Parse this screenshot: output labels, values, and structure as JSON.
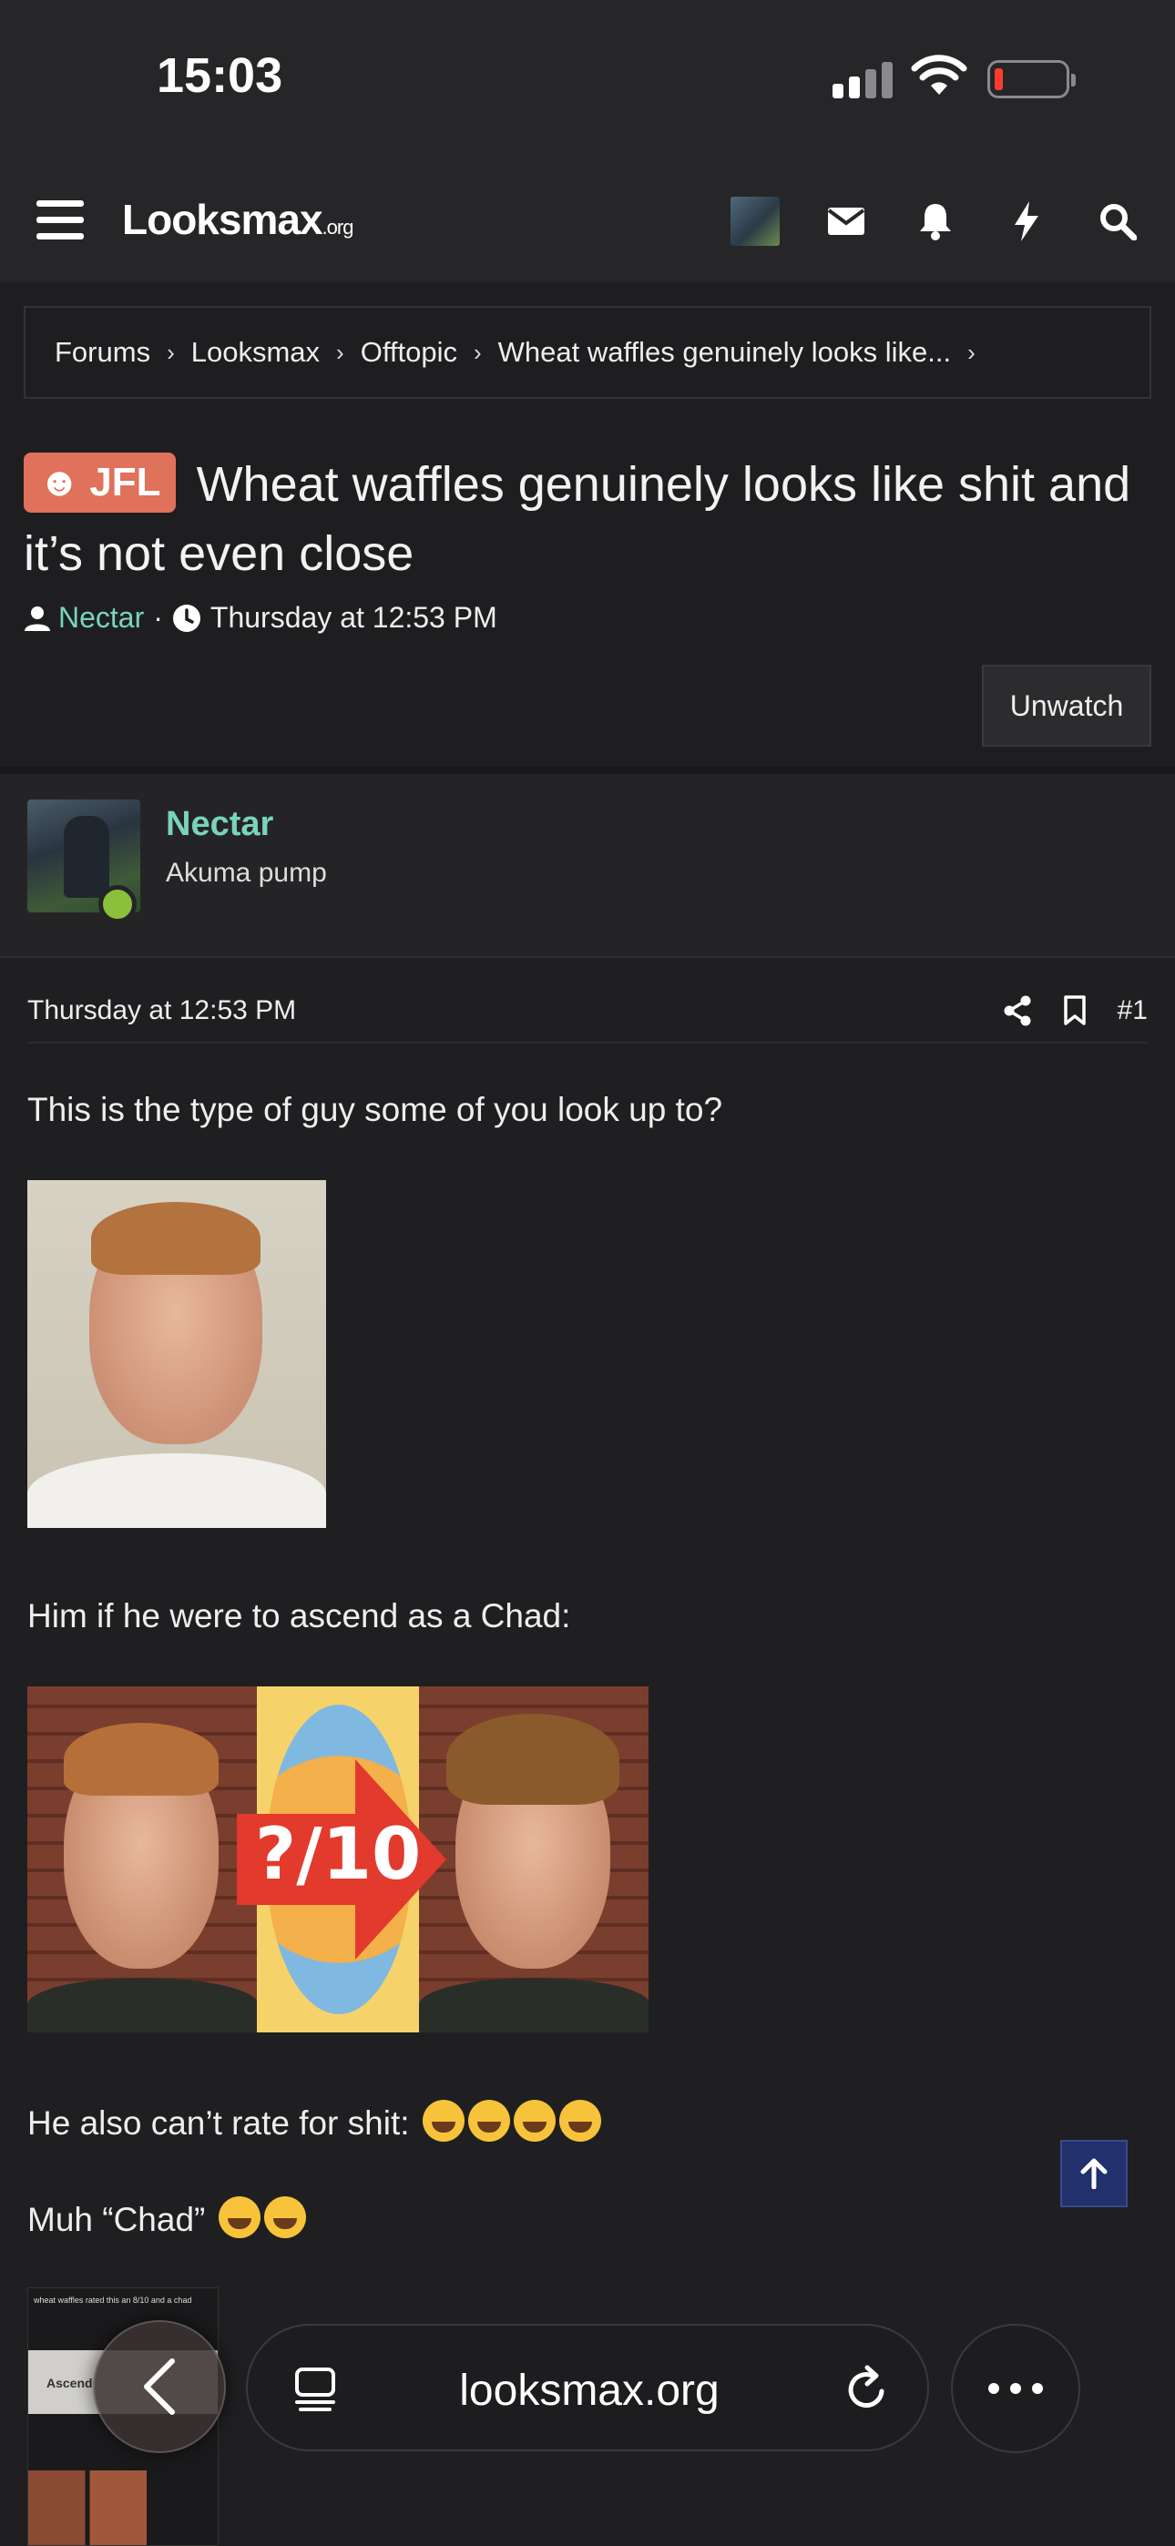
{
  "status_bar": {
    "time": "15:03"
  },
  "header": {
    "logo_main": "Looksmax",
    "logo_suffix": ".org",
    "icons": [
      "menu-icon",
      "avatar",
      "mail-icon",
      "bell-icon",
      "lightning-icon",
      "search-icon"
    ]
  },
  "breadcrumb": {
    "items": [
      "Forums",
      "Looksmax",
      "Offtopic",
      "Wheat waffles genuinely looks like..."
    ]
  },
  "thread": {
    "prefix": "JFL",
    "title": "Wheat waffles genuinely looks like shit and it’s not even close",
    "author": "Nectar",
    "separator": "·",
    "date": "Thursday at 12:53 PM",
    "unwatch_label": "Unwatch"
  },
  "post": {
    "author": "Nectar",
    "user_title": "Akuma pump",
    "date": "Thursday at 12:53 PM",
    "number": "#1",
    "paragraphs": [
      "This is the type of guy some of you look up to?",
      "Him if he were to ascend as a Chad:",
      "He also can’t rate for shit:",
      "Muh “Chad”"
    ],
    "rating_overlay": "?/10",
    "thumb_caption": "wheat waffles rated this an 8/10 and a chad",
    "thumb_label": "Ascend"
  },
  "browser": {
    "url": "looksmax.org"
  },
  "colors": {
    "accent_user": "#7ad4b8",
    "badge_jfl": "#e0715a",
    "online": "#8bc13a",
    "scroll_top": "#22306e"
  }
}
